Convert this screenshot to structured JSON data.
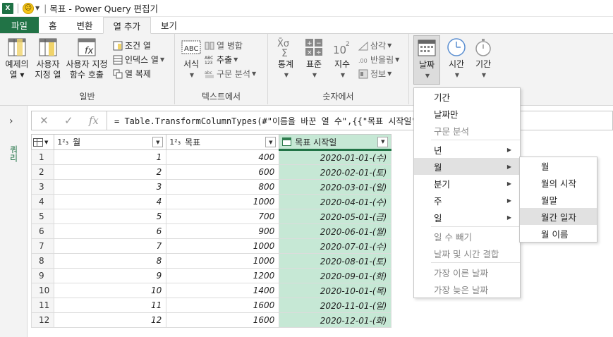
{
  "title": {
    "qat_separator": "|",
    "text": "목표 - Power Query 편집기",
    "app_badge": "X"
  },
  "tabs": [
    "파일",
    "홈",
    "변환",
    "열 추가",
    "보기"
  ],
  "ribbon": {
    "general": {
      "label": "일반",
      "example_col": [
        "예제의",
        "열 ▾"
      ],
      "custom_col": [
        "사용자",
        "지정 열"
      ],
      "invoke_fn": [
        "사용자 지정",
        "함수 호출"
      ],
      "conditional": "조건 열",
      "index": "인덱스 열",
      "duplicate": "열 복제"
    },
    "text": {
      "label": "텍스트에서",
      "format": "서식",
      "merge": "열 병합",
      "extract": "추출",
      "parse": "구문 분석"
    },
    "number": {
      "label": "숫자에서",
      "stats": "통계",
      "standard": "표준",
      "scientific": "지수",
      "trig": "삼각",
      "rounding": "반올림",
      "info": "정보"
    },
    "datetime": {
      "date": "날짜",
      "time": "시간",
      "duration": "기간"
    }
  },
  "querypane": {
    "label": "쿼리"
  },
  "formula": {
    "text": "= Table.TransformColumnTypes(#\"이름을 바꾼 열 수\",{{\"목표 시작일\","
  },
  "grid": {
    "headers": [
      {
        "type": "1²₃",
        "name": "월"
      },
      {
        "type": "1²₃",
        "name": "목표"
      },
      {
        "type": "date",
        "name": "목표 시작일"
      }
    ],
    "rows": [
      [
        "1",
        "1",
        "400",
        "2020-01-01-(수)"
      ],
      [
        "2",
        "2",
        "600",
        "2020-02-01-(토)"
      ],
      [
        "3",
        "3",
        "800",
        "2020-03-01-(일)"
      ],
      [
        "4",
        "4",
        "1000",
        "2020-04-01-(수)"
      ],
      [
        "5",
        "5",
        "700",
        "2020-05-01-(금)"
      ],
      [
        "6",
        "6",
        "900",
        "2020-06-01-(월)"
      ],
      [
        "7",
        "7",
        "1000",
        "2020-07-01-(수)"
      ],
      [
        "8",
        "8",
        "1000",
        "2020-08-01-(토)"
      ],
      [
        "9",
        "9",
        "1200",
        "2020-09-01-(화)"
      ],
      [
        "10",
        "10",
        "1400",
        "2020-10-01-(목)"
      ],
      [
        "11",
        "11",
        "1600",
        "2020-11-01-(일)"
      ],
      [
        "12",
        "12",
        "1600",
        "2020-12-01-(화)"
      ]
    ]
  },
  "date_menu": {
    "items": [
      {
        "label": "기간",
        "disabled": false,
        "sub": false
      },
      {
        "label": "날짜만",
        "disabled": false,
        "sub": false
      },
      {
        "label": "구문 분석",
        "disabled": true,
        "sub": false
      },
      {
        "label": "년",
        "disabled": false,
        "sub": true
      },
      {
        "label": "월",
        "disabled": false,
        "sub": true,
        "highlight": true
      },
      {
        "label": "분기",
        "disabled": false,
        "sub": true
      },
      {
        "label": "주",
        "disabled": false,
        "sub": true
      },
      {
        "label": "일",
        "disabled": false,
        "sub": true
      },
      {
        "label": "일 수 빼기",
        "disabled": true,
        "sub": false
      },
      {
        "label": "날짜 및 시간 결합",
        "disabled": true,
        "sub": false
      },
      {
        "label": "가장 이른 날짜",
        "disabled": true,
        "sub": false
      },
      {
        "label": "가장 늦은 날짜",
        "disabled": true,
        "sub": false
      }
    ]
  },
  "month_menu": {
    "items": [
      {
        "label": "월",
        "highlight": false
      },
      {
        "label": "월의 시작",
        "highlight": false
      },
      {
        "label": "월말",
        "highlight": false
      },
      {
        "label": "월간 일자",
        "highlight": true
      },
      {
        "label": "월 이름",
        "highlight": false
      }
    ]
  },
  "colors": {
    "excel_green": "#217346",
    "selected_col": "#c6e8d5"
  }
}
